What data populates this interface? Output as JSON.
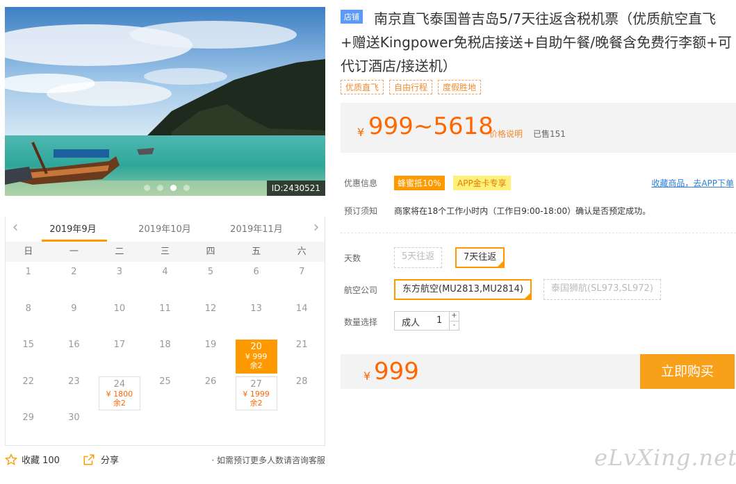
{
  "hero": {
    "id_label": "ID:2430521",
    "dots": 4,
    "active_dot": 2
  },
  "calendar": {
    "months": [
      "2019年9月",
      "2019年10月",
      "2019年11月"
    ],
    "active_month": 0,
    "weekdays": [
      "日",
      "一",
      "二",
      "三",
      "四",
      "五",
      "六"
    ],
    "start_offset": 0,
    "days_in_month": 30,
    "special": {
      "20": {
        "price": "¥ 999",
        "left": "余2",
        "state": "selected"
      },
      "24": {
        "price": "¥ 1800",
        "left": "余2",
        "state": "available"
      },
      "27": {
        "price": "¥ 1999",
        "left": "余2",
        "state": "available"
      }
    }
  },
  "footer": {
    "fav_label": "收藏 100",
    "share_label": "分享",
    "tip": "· 如需预订更多人数请咨询客服"
  },
  "product": {
    "badge": "店铺",
    "title": "南京直飞泰国普吉岛5/7天往返含税机票（优质航空直飞+赠送Kingpower免税店接送+自助午餐/晚餐含免费行李额+可代订酒店/接送机）",
    "tags": [
      "优质直飞",
      "自由行程",
      "度假胜地"
    ]
  },
  "price": {
    "currency": "¥",
    "range": "999~5618",
    "note": "价格说明",
    "sold": "已售151"
  },
  "promo": {
    "label": "优惠信息",
    "discount": "蜂蜜抵10%",
    "app_vip": "APP金卡专享",
    "app_link": "收藏商品，去APP下单"
  },
  "notice": {
    "label": "预订须知",
    "text": "商家将在18个工作小时内（工作日9:00-18:00）确认是否预定成功。"
  },
  "options": {
    "days_label": "天数",
    "days": [
      {
        "label": "5天往返",
        "state": "disabled"
      },
      {
        "label": "7天往返",
        "state": "selected"
      }
    ],
    "airline_label": "航空公司",
    "airlines": [
      {
        "label": "东方航空(MU2813,MU2814)",
        "state": "selected"
      },
      {
        "label": "泰国狮航(SL973,SL972)",
        "state": "disabled"
      }
    ],
    "qty_label": "数量选择",
    "qty_type": "成人",
    "qty_value": "1",
    "plus": "+",
    "minus": "-"
  },
  "buy": {
    "currency": "¥",
    "price": "999",
    "button": "立即购买"
  },
  "watermark": "eLvXing.net",
  "colors": {
    "accent": "#ff9900",
    "price": "#ff6600",
    "link": "#2b7ed3",
    "badge": "#5b9bf6"
  }
}
